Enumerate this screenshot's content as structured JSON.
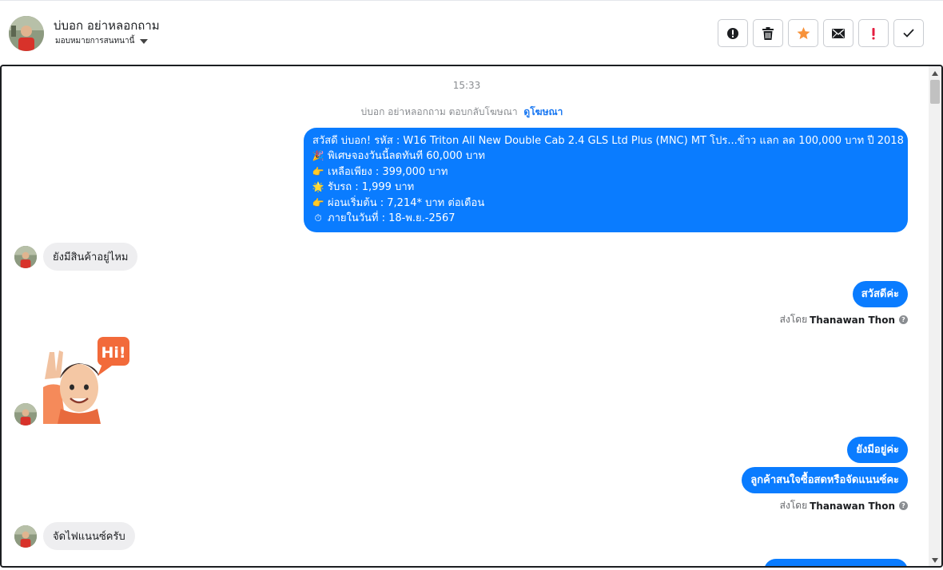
{
  "header": {
    "contact_name": "บ่บอก อย่าหลอกถาม",
    "assign_label": "มอบหมายการสนทนานี้"
  },
  "toolbar": {
    "buttons": [
      {
        "icon": "alert-circle-icon"
      },
      {
        "icon": "trash-icon"
      },
      {
        "icon": "star-icon",
        "color": "#f7923a"
      },
      {
        "icon": "mail-icon"
      },
      {
        "icon": "exclamation-icon",
        "color": "#e41e3f"
      },
      {
        "icon": "check-icon"
      }
    ]
  },
  "chat": {
    "timestamp": "15:33",
    "ad_reply_text": "บ่บอก อย่าหลอกถาม ตอบกลับโฆษณา",
    "ad_reply_link": "ดูโฆษณา",
    "ad_message": {
      "lines": [
        {
          "emoji": "",
          "text": "สวัสดี บ่บอก! รหัส : W16 Triton All New Double Cab 2.4 GLS Ltd Plus (MNC) MT โปร...ข้าว แลก ลด 100,000 บาท ปี 2018"
        },
        {
          "emoji": "🎉",
          "text": "พิเศษจองวันนี้ลดทันที 60,000 บาท"
        },
        {
          "emoji": "👉",
          "text": "เหลือเพียง : 399,000 บาท"
        },
        {
          "emoji": "🌟",
          "text": "รับรถ : 1,999 บาท"
        },
        {
          "emoji": "👉",
          "text": "ผ่อนเริ่มต้น : 7,214* บาท ต่อเดือน"
        },
        {
          "emoji": "⏱",
          "text": "ภายในวันที่ : 18-พ.ย.-2567"
        }
      ]
    },
    "messages": {
      "in_1": "ยังมีสินค้าอยู่ไหม",
      "out_1": "สวัสดีค่ะ",
      "sticker_text": "Hi!",
      "out_2": "ยังมีอยู่ค่ะ",
      "out_3": "ลูกค้าสนใจซื้อสดหรือจัดแนนซ์คะ",
      "in_2": "จัดไฟแนนซ์ครับ"
    },
    "sent_by_prefix": "ส่งโดย",
    "sent_by_name": "Thanawan Thon"
  }
}
